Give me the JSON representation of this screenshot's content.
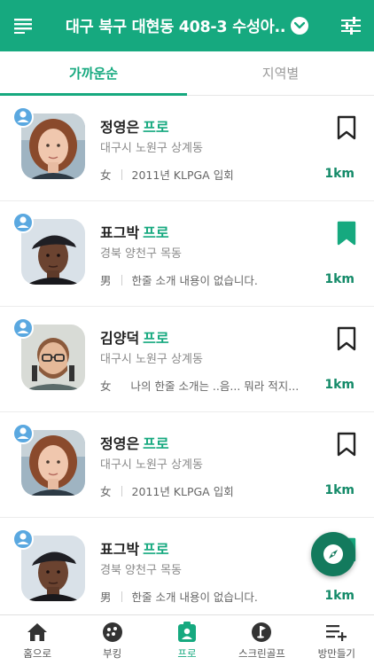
{
  "header": {
    "location": "대구 북구 대현동 408-3 수성아..",
    "menu_icon": "menu-icon",
    "chevron_icon": "chevron-down-circle-icon",
    "filter_icon": "sliders-icon"
  },
  "tabs": [
    {
      "label": "가까운순",
      "active": true
    },
    {
      "label": "지역별",
      "active": false
    }
  ],
  "pros": [
    {
      "name": "정영은",
      "title": "프로",
      "region": "대구시 노원구 상계동",
      "gender": "女",
      "intro": "2011년 KLPGA 입회",
      "distance": "1km",
      "bookmarked": false,
      "photo": "female-portrait"
    },
    {
      "name": "표그박",
      "title": "프로",
      "region": "경북 양천구 목동",
      "gender": "男",
      "intro": "한줄 소개 내용이 없습니다.",
      "distance": "1km",
      "bookmarked": true,
      "photo": "male-portrait-cap"
    },
    {
      "name": "김양덕",
      "title": "프로",
      "region": "대구시 노원구 상계동",
      "gender": "女",
      "intro": "나의 한줄 소개는 ..음... 뭐라 적지...남",
      "distance": "1km",
      "bookmarked": false,
      "photo": "male-portrait-glasses"
    },
    {
      "name": "정영은",
      "title": "프로",
      "region": "대구시 노원구 상계동",
      "gender": "女",
      "intro": "2011년 KLPGA 입회",
      "distance": "1km",
      "bookmarked": false,
      "photo": "female-portrait"
    },
    {
      "name": "표그박",
      "title": "프로",
      "region": "경북 양천구 목동",
      "gender": "男",
      "intro": "한줄 소개 내용이 없습니다.",
      "distance": "1km",
      "bookmarked": true,
      "photo": "male-portrait-cap"
    }
  ],
  "fab": {
    "icon": "compass-icon"
  },
  "bottom_nav": [
    {
      "label": "홈으로",
      "icon": "home-icon",
      "active": false
    },
    {
      "label": "부킹",
      "icon": "golf-ball-icon",
      "active": false
    },
    {
      "label": "프로",
      "icon": "pro-badge-icon",
      "active": true
    },
    {
      "label": "스크린골프",
      "icon": "screen-golf-icon",
      "active": false
    },
    {
      "label": "방만들기",
      "icon": "playlist-add-icon",
      "active": false
    }
  ],
  "colors": {
    "brand": "#16a97f",
    "distance": "#138a68",
    "fab": "#137a5d",
    "badge": "#5aa8e0"
  }
}
